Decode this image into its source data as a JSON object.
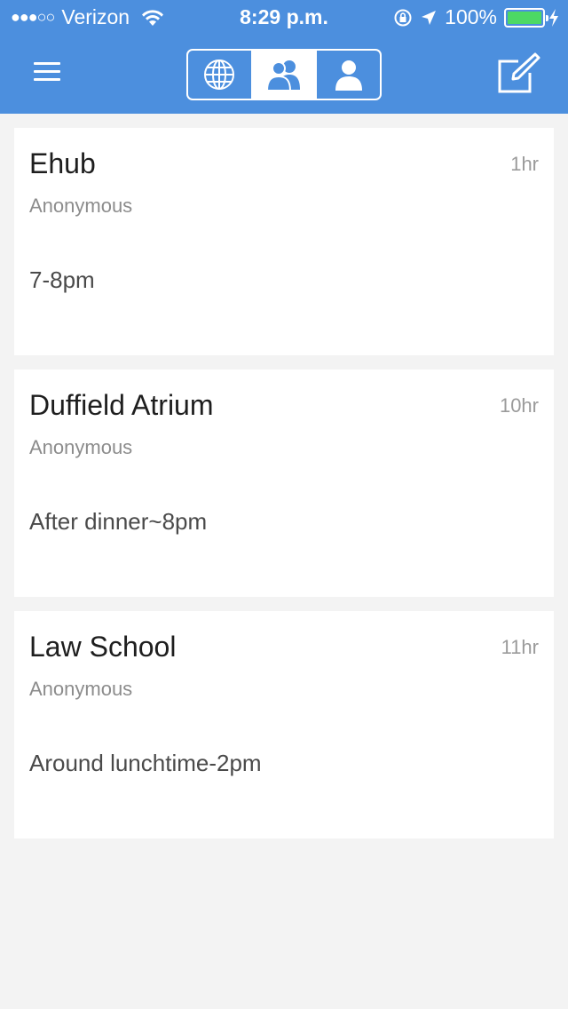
{
  "status_bar": {
    "signal": "●●●○○",
    "carrier": "Verizon",
    "time": "8:29 p.m.",
    "battery": "100%",
    "battery_level": 1.0
  },
  "nav": {
    "tabs": [
      {
        "icon": "globe-icon",
        "active": false
      },
      {
        "icon": "group-icon",
        "active": true
      },
      {
        "icon": "person-icon",
        "active": false
      }
    ],
    "left_icon": "hamburger-menu-icon",
    "right_icon": "compose-icon"
  },
  "colors": {
    "header": "#4c8fde",
    "background": "#f3f3f3",
    "card": "#ffffff",
    "battery": "#4cd964"
  },
  "posts": [
    {
      "title": "Ehub",
      "time": "1hr",
      "author": "Anonymous",
      "body": "7-8pm"
    },
    {
      "title": "Duffield Atrium",
      "time": "10hr",
      "author": "Anonymous",
      "body": "After dinner~8pm"
    },
    {
      "title": "Law School",
      "time": "11hr",
      "author": "Anonymous",
      "body": "Around lunchtime-2pm"
    }
  ]
}
